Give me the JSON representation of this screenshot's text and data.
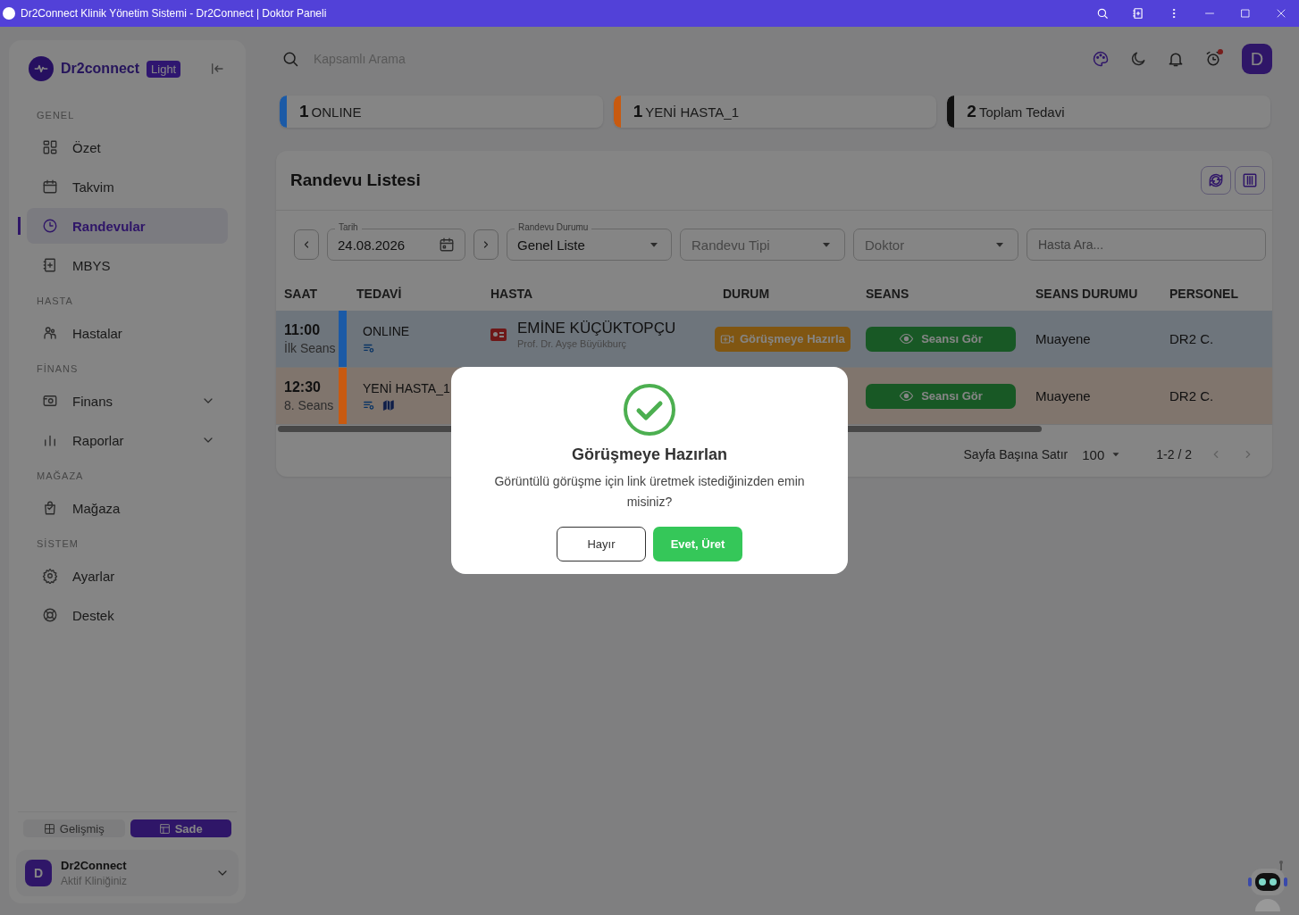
{
  "window": {
    "title": "Dr2Connect Klinik Yönetim Sistemi - Dr2Connect | Doktor Paneli"
  },
  "sidebar": {
    "brand": "Dr2connect",
    "badge": "Light",
    "sections": [
      {
        "title": "GENEL",
        "items": [
          {
            "label": "Özet",
            "kind": "link",
            "selected": false
          },
          {
            "label": "Takvim",
            "kind": "link",
            "selected": false
          },
          {
            "label": "Randevular",
            "kind": "link",
            "selected": true
          },
          {
            "label": "MBYS",
            "kind": "link",
            "selected": false
          }
        ]
      },
      {
        "title": "HASTA",
        "items": [
          {
            "label": "Hastalar",
            "kind": "link",
            "selected": false
          }
        ]
      },
      {
        "title": "FİNANS",
        "items": [
          {
            "label": "Finans",
            "kind": "group",
            "selected": false
          },
          {
            "label": "Raporlar",
            "kind": "group",
            "selected": false
          }
        ]
      },
      {
        "title": "MAĞAZA",
        "items": [
          {
            "label": "Mağaza",
            "kind": "link",
            "selected": false
          }
        ]
      },
      {
        "title": "SİSTEM",
        "items": [
          {
            "label": "Ayarlar",
            "kind": "link",
            "selected": false
          },
          {
            "label": "Destek",
            "kind": "link",
            "selected": false
          }
        ]
      }
    ],
    "view_modes": [
      {
        "label": "Gelişmiş",
        "selected": false
      },
      {
        "label": "Sade",
        "selected": true
      }
    ],
    "clinic": {
      "avatar": "D",
      "name": "Dr2Connect",
      "subtitle": "Aktif Kliniğiniz"
    }
  },
  "topbar": {
    "search_placeholder": "Kapsamlı Arama",
    "avatar": "D"
  },
  "stats": [
    {
      "count": "1",
      "label": "ONLINE",
      "color": "#1b5aa6"
    },
    {
      "count": "1",
      "label": "YENİ HASTA_1",
      "color": "#c85a10"
    },
    {
      "count": "2",
      "label": "Toplam Tedavi",
      "color": "#111111"
    }
  ],
  "appointments": {
    "title": "Randevu Listesi",
    "filters": {
      "date_label": "Tarih",
      "date": "24.08.2026",
      "status_label": "Randevu Durumu",
      "status": "Genel Liste",
      "type_placeholder": "Randevu Tipi",
      "doctor_placeholder": "Doktor",
      "search_placeholder": "Hasta Ara..."
    },
    "columns": [
      "SAAT",
      "TEDAVİ",
      "HASTA",
      "DURUM",
      "SEANS",
      "SEANS DURUMU",
      "PERSONEL"
    ],
    "rows": [
      {
        "time": "11:00",
        "session": "İlk Seans",
        "treatment": "ONLINE",
        "color": "#1b5aa6",
        "location": false,
        "patient": "EMİNE KÜÇÜKTOPÇU",
        "doctor": "Prof. Dr. Ayşe Büyükburç",
        "status": "Görüşmeye Hazırla",
        "session_button": "Seansı Gör",
        "session_status": "Muayene",
        "staff": "DR2 C."
      },
      {
        "time": "12:30",
        "session": "8. Seans",
        "treatment": "YENİ HASTA_1",
        "color": "#c85a10",
        "location": true,
        "session_button": "Seansı Gör",
        "session_status": "Muayene",
        "staff": "DR2 C."
      }
    ],
    "pagination": {
      "rows_label": "Sayfa Başına Satır",
      "rows_value": "100",
      "range": "1-2 / 2"
    }
  },
  "dialog": {
    "title": "Görüşmeye Hazırlan",
    "message": "Görüntülü görüşme için link üretmek istediğinizden emin misiniz?",
    "cancel": "Hayır",
    "confirm": "Evet, Üret"
  }
}
